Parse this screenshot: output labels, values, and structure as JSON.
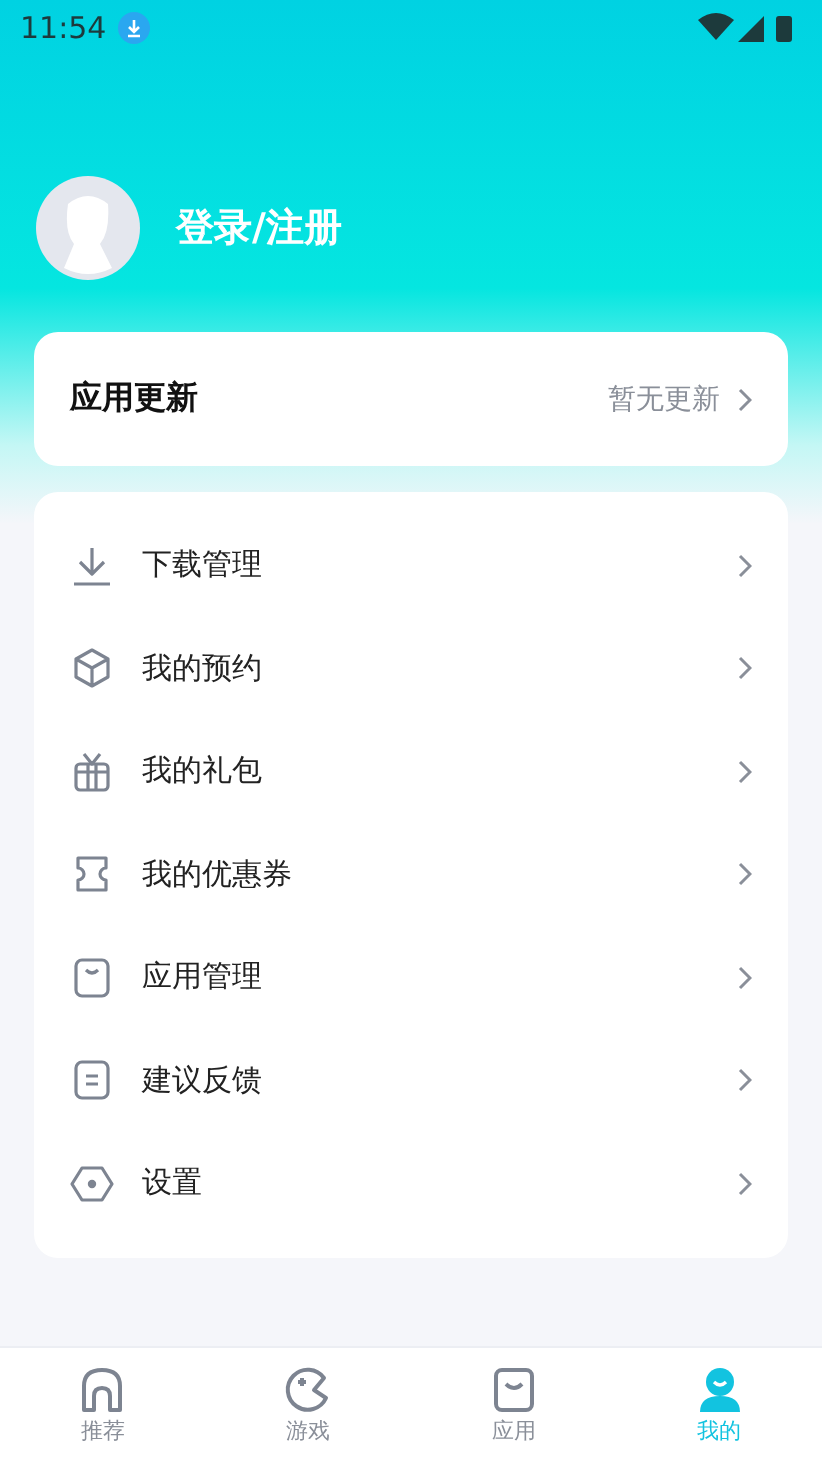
{
  "status_bar": {
    "time": "11:54"
  },
  "profile": {
    "login_label": "登录/注册"
  },
  "update_card": {
    "title": "应用更新",
    "status": "暂无更新"
  },
  "menu": [
    {
      "kind": "download",
      "label": "下载管理"
    },
    {
      "kind": "box",
      "label": "我的预约"
    },
    {
      "kind": "gift",
      "label": "我的礼包"
    },
    {
      "kind": "ticket",
      "label": "我的优惠券"
    },
    {
      "kind": "bag",
      "label": "应用管理"
    },
    {
      "kind": "note",
      "label": "建议反馈"
    },
    {
      "kind": "settings",
      "label": "设置"
    }
  ],
  "tabs": [
    {
      "kind": "home",
      "label": "推荐",
      "selected": false
    },
    {
      "kind": "game",
      "label": "游戏",
      "selected": false
    },
    {
      "kind": "bag",
      "label": "应用",
      "selected": false
    },
    {
      "kind": "me",
      "label": "我的",
      "selected": true
    }
  ]
}
